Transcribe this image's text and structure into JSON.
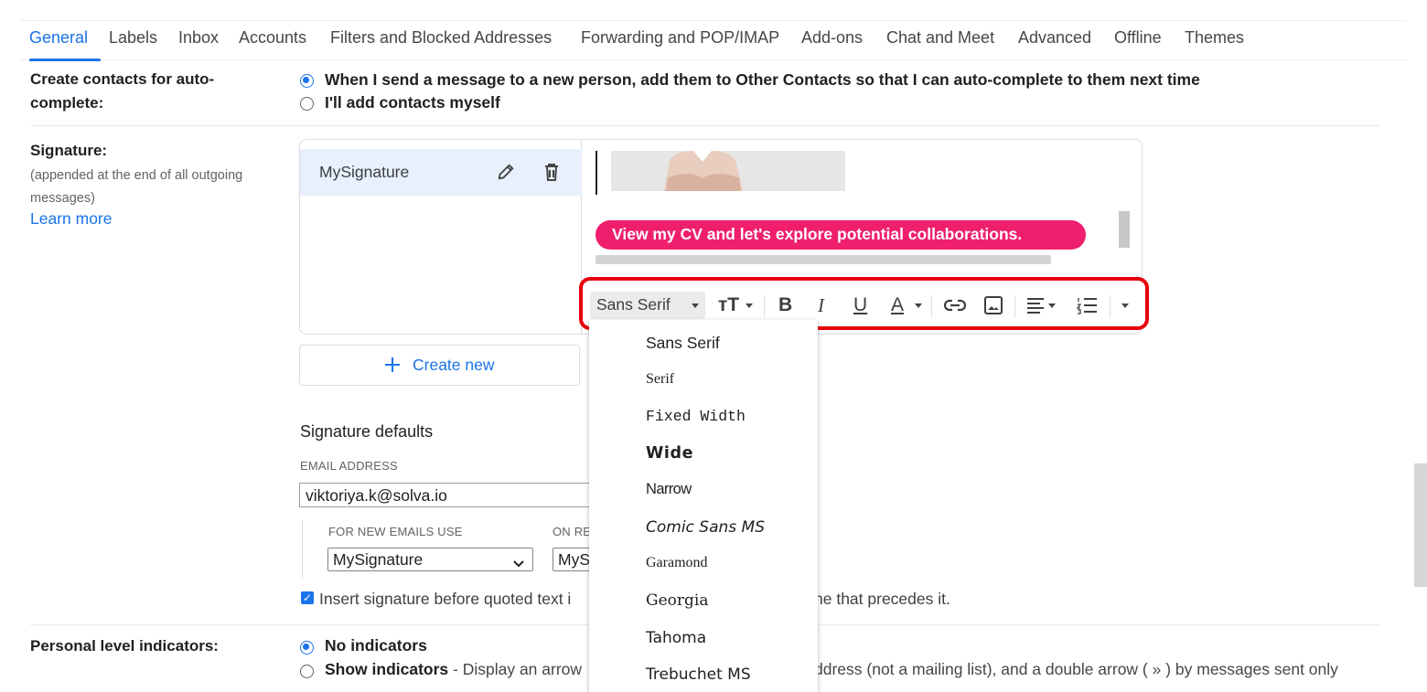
{
  "tabs": [
    {
      "label": "General"
    },
    {
      "label": "Labels"
    },
    {
      "label": "Inbox"
    },
    {
      "label": "Accounts"
    },
    {
      "label": "Filters and Blocked Addresses"
    },
    {
      "label": "Forwarding and POP/IMAP"
    },
    {
      "label": "Add-ons"
    },
    {
      "label": "Chat and Meet"
    },
    {
      "label": "Advanced"
    },
    {
      "label": "Offline"
    },
    {
      "label": "Themes"
    }
  ],
  "contacts": {
    "label_line1": "Create contacts for auto-",
    "label_line2": "complete:",
    "option1": "When I send a message to a new person, add them to Other Contacts so that I can auto-complete to them next time",
    "option2": "I'll add contacts myself"
  },
  "signature": {
    "label": "Signature:",
    "sub_line1": "(appended at the end of all outgoing",
    "sub_line2": "messages)",
    "learn_more": "Learn more",
    "item_name": "MySignature",
    "cv_button": "View my CV and let's explore potential collaborations.",
    "create_new": "Create new",
    "defaults_title": "Signature defaults",
    "email_label": "EMAIL ADDRESS",
    "email_value": "viktoriya.k@solva.io",
    "new_emails_label": "FOR NEW EMAILS USE",
    "new_emails_value": "MySignature",
    "reply_label": "ON RE",
    "reply_value": "MyS",
    "insert_before_left": "Insert signature before quoted text i",
    "insert_before_right": "ne that precedes it."
  },
  "toolbar": {
    "font": "Sans Serif",
    "size_icon": "тT",
    "bold": "B",
    "italic": "I",
    "underline": "U",
    "text_color": "A",
    "accent_color": "#e8000b"
  },
  "font_menu": [
    "Sans Serif",
    "Serif",
    "Fixed Width",
    "Wide",
    "Narrow",
    "Comic Sans MS",
    "Garamond",
    "Georgia",
    "Tahoma",
    "Trebuchet MS"
  ],
  "indicators": {
    "label": "Personal level indicators:",
    "option1": "No indicators",
    "option2_bold": "Show indicators",
    "option2_desc": " - Display an arrow",
    "option2_right": "ddress (not a mailing list), and a double arrow ( » ) by messages sent only"
  }
}
